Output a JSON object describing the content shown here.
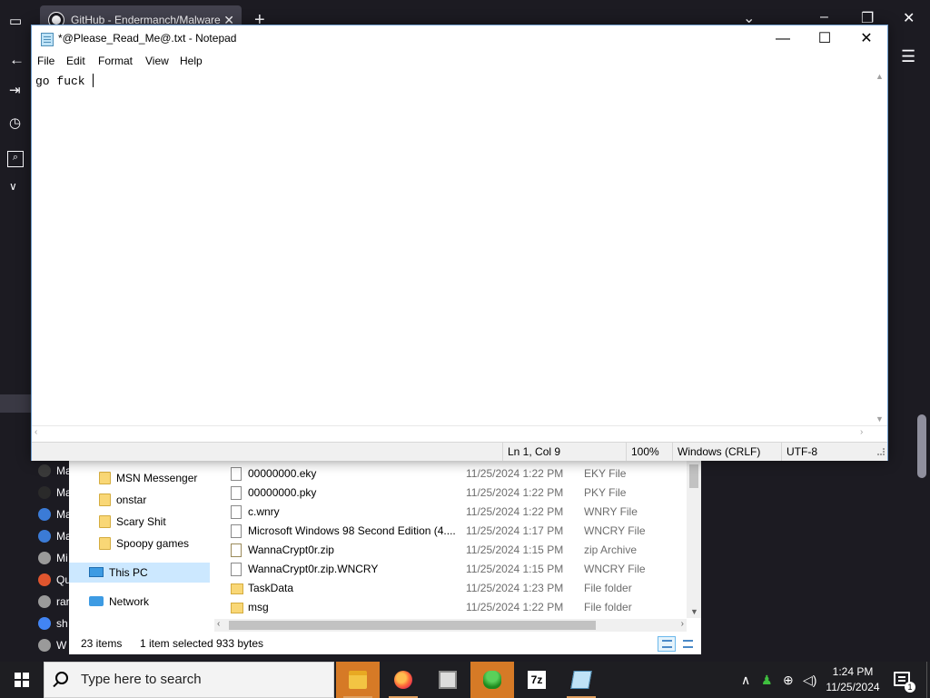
{
  "browser": {
    "tab_title": "GitHub - Endermanch/Malware",
    "tab_close": "✕",
    "new_tab": "+",
    "ctrl_chevron": "⌄",
    "ctrl_min": "–",
    "ctrl_restore": "❐",
    "ctrl_close": "✕",
    "menu_icon": "☰",
    "bookmarks": [
      {
        "label": "Ma",
        "color": "#3a3a3a"
      },
      {
        "label": "Ma",
        "color": "#2a2a2a"
      },
      {
        "label": "Ma",
        "color": "#3b7bd6"
      },
      {
        "label": "Ma",
        "color": "#3b7bd6"
      },
      {
        "label": "Mi",
        "color": "#9a9a9a"
      },
      {
        "label": "Qu",
        "color": "#e0552e"
      },
      {
        "label": "rar",
        "color": "#9a9a9a"
      },
      {
        "label": "sh",
        "color": "#4285f4"
      },
      {
        "label": "W",
        "color": "#9a9a9a"
      }
    ]
  },
  "notepad": {
    "title": "*@Please_Read_Me@.txt - Notepad",
    "minimize": "—",
    "maximize": "☐",
    "close": "✕",
    "menus": [
      "File",
      "Edit",
      "Format",
      "View",
      "Help"
    ],
    "content": "go fuck ",
    "status": {
      "position": "Ln 1, Col 9",
      "zoom": "100%",
      "line_endings": "Windows (CRLF)",
      "encoding": "UTF-8"
    }
  },
  "explorer": {
    "nav_items": [
      "MSN Messenger",
      "onstar",
      "Scary Shit",
      "Spoopy games"
    ],
    "this_pc": "This PC",
    "network": "Network",
    "files": [
      {
        "name": "00000000.eky",
        "date": "11/25/2024 1:22 PM",
        "type": "EKY File",
        "icon": "file"
      },
      {
        "name": "00000000.pky",
        "date": "11/25/2024 1:22 PM",
        "type": "PKY File",
        "icon": "file"
      },
      {
        "name": "c.wnry",
        "date": "11/25/2024 1:22 PM",
        "type": "WNRY File",
        "icon": "file"
      },
      {
        "name": "Microsoft Windows 98 Second Edition (4....",
        "date": "11/25/2024 1:17 PM",
        "type": "WNCRY File",
        "icon": "file"
      },
      {
        "name": "WannaCrypt0r.zip",
        "date": "11/25/2024 1:15 PM",
        "type": "zip Archive",
        "icon": "zip"
      },
      {
        "name": "WannaCrypt0r.zip.WNCRY",
        "date": "11/25/2024 1:15 PM",
        "type": "WNCRY File",
        "icon": "file"
      },
      {
        "name": "TaskData",
        "date": "11/25/2024 1:23 PM",
        "type": "File folder",
        "icon": "folder"
      },
      {
        "name": "msg",
        "date": "11/25/2024 1:22 PM",
        "type": "File folder",
        "icon": "folder"
      }
    ],
    "status": {
      "items": "23 items",
      "selected": "1 item selected",
      "size": "933 bytes"
    }
  },
  "taskbar": {
    "search_placeholder": "Type here to search",
    "apps": [
      "file-explorer",
      "firefox",
      "photos",
      "msn-messenger",
      "7-zip",
      "notepad"
    ],
    "seven_zip_label": "7z",
    "tray_up": "∧",
    "tray_speaker": "🔊",
    "time": "1:24 PM",
    "date": "11/25/2024",
    "notifications_count": "1",
    "accent": "#d67a26"
  }
}
